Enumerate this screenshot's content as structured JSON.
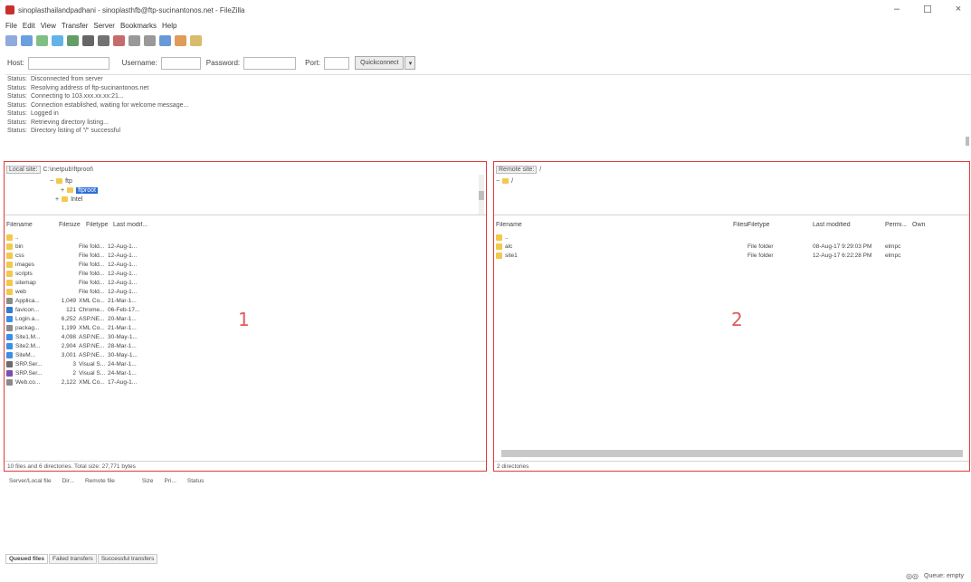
{
  "window": {
    "title": "sinoplasthailandpadhani - sinoplasthfb@ftp-sucinantonos.net - FileZilla",
    "controls": [
      "–",
      "☐",
      "×"
    ]
  },
  "menu": [
    "File",
    "Edit",
    "View",
    "Transfer",
    "Server",
    "Bookmarks",
    "Help"
  ],
  "toolbar_icons": [
    "site-manager-icon",
    "toggle-log-icon",
    "toggle-tree-icon",
    "toggle-remote-icon",
    "refresh-icon",
    "process-queue-icon",
    "cancel-icon",
    "disconnect-icon",
    "reconnect-icon",
    "filter-icon",
    "compare-icon",
    "sync-icon",
    "search-icon"
  ],
  "quickconnect": {
    "host_label": "Host:",
    "username_label": "Username:",
    "password_label": "Password:",
    "port_label": "Port:",
    "button_label": "Quickconnect",
    "dropdown": "▾"
  },
  "message_log": [
    {
      "k": "Status:",
      "v": "Disconnected from server"
    },
    {
      "k": "Status:",
      "v": "Resolving address of ftp-sucinantonos.net"
    },
    {
      "k": "Status:",
      "v": "Connecting to 103.xxx.xx.xx:21..."
    },
    {
      "k": "Status:",
      "v": "Connection established, waiting for welcome message..."
    },
    {
      "k": "Status:",
      "v": "Logged in"
    },
    {
      "k": "Status:",
      "v": "Retrieving directory listing..."
    },
    {
      "k": "Status:",
      "v": "Directory listing of \"/\" successful"
    }
  ],
  "local": {
    "site_label": "Local site:",
    "path": "C:\\inetpub\\ftproot\\",
    "tree": [
      {
        "indent": 48,
        "exp": "−",
        "name": "ftp"
      },
      {
        "indent": 60,
        "exp": "+",
        "name": "ftproot",
        "selected": true
      },
      {
        "indent": 54,
        "exp": "+",
        "name": "Intel"
      }
    ],
    "columns": [
      "Filename",
      "Filesize",
      "Filetype",
      "Last modif..."
    ],
    "files": [
      {
        "icon": "folder",
        "name": "..",
        "size": "",
        "type": "",
        "date": ""
      },
      {
        "icon": "folder",
        "name": "bin",
        "size": "",
        "type": "File fold...",
        "date": "12-Aug-1..."
      },
      {
        "icon": "folder",
        "name": "css",
        "size": "",
        "type": "File fold...",
        "date": "12-Aug-1..."
      },
      {
        "icon": "folder",
        "name": "images",
        "size": "",
        "type": "File fold...",
        "date": "12-Aug-1..."
      },
      {
        "icon": "folder",
        "name": "scripts",
        "size": "",
        "type": "File fold...",
        "date": "12-Aug-1..."
      },
      {
        "icon": "folder",
        "name": "sitemap",
        "size": "",
        "type": "File fold...",
        "date": "12-Aug-1..."
      },
      {
        "icon": "folder",
        "name": "web",
        "size": "",
        "type": "File fold...",
        "date": "12-Aug-1..."
      },
      {
        "icon": "doc",
        "name": "Applica...",
        "size": "1,049",
        "type": "XML Co...",
        "date": "21-Mar-1..."
      },
      {
        "icon": "ie",
        "name": "favicon...",
        "size": "121",
        "type": "Chrome...",
        "date": "06-Feb-17..."
      },
      {
        "icon": "aspx",
        "name": "Login.a...",
        "size": "6,252",
        "type": "ASP.NE...",
        "date": "20-Mar-1..."
      },
      {
        "icon": "doc",
        "name": "packag...",
        "size": "1,199",
        "type": "XML Co...",
        "date": "21-Mar-1..."
      },
      {
        "icon": "aspx",
        "name": "Site1.M...",
        "size": "4,098",
        "type": "ASP.NE...",
        "date": "30-May-1..."
      },
      {
        "icon": "aspx",
        "name": "Site2.M...",
        "size": "2,904",
        "type": "ASP.NE...",
        "date": "28-Mar-1..."
      },
      {
        "icon": "aspx",
        "name": "SiteM...",
        "size": "3,001",
        "type": "ASP.NE...",
        "date": "30-May-1..."
      },
      {
        "icon": "sln",
        "name": "SRP.Ser...",
        "size": "3",
        "type": "Visual S...",
        "date": "24-Mar-1..."
      },
      {
        "icon": "vs",
        "name": "SRP.Ser...",
        "size": "2",
        "type": "Visual S...",
        "date": "24-Mar-1..."
      },
      {
        "icon": "doc",
        "name": "Web.co...",
        "size": "2,122",
        "type": "XML Co...",
        "date": "17-Aug-1..."
      }
    ],
    "status": "10 files and 6 directories. Total size: 27,771 bytes"
  },
  "remote": {
    "site_label": "Remote site:",
    "path": "/",
    "tree": [
      {
        "exp": "−",
        "name": "/"
      }
    ],
    "columns": [
      "Filename",
      "Filesize",
      "Filetype",
      "Last modified",
      "Permi...",
      "Own"
    ],
    "files": [
      {
        "name": "..",
        "size": "",
        "type": "",
        "date": "",
        "perm": ""
      },
      {
        "name": "alc",
        "size": "",
        "type": "File folder",
        "date": "08-Aug-17 9:29:03 PM",
        "perm": "elmpc"
      },
      {
        "name": "site1",
        "size": "",
        "type": "File folder",
        "date": "12-Aug-17 6:22:28 PM",
        "perm": "elmpc"
      }
    ],
    "status": "2 directories"
  },
  "annotations": {
    "left": "1",
    "right": "2"
  },
  "queue": {
    "columns": [
      "Server/Local file",
      "Dir...",
      "Remote file",
      "Size",
      "Pri...",
      "Status"
    ],
    "tabs": [
      "Queued files",
      "Failed transfers",
      "Successful transfers"
    ],
    "status_text": "Queue: empty"
  },
  "colors": {
    "highlight": "#e03a3a",
    "selection": "#2b6cd9",
    "folder": "#f2c94c"
  }
}
